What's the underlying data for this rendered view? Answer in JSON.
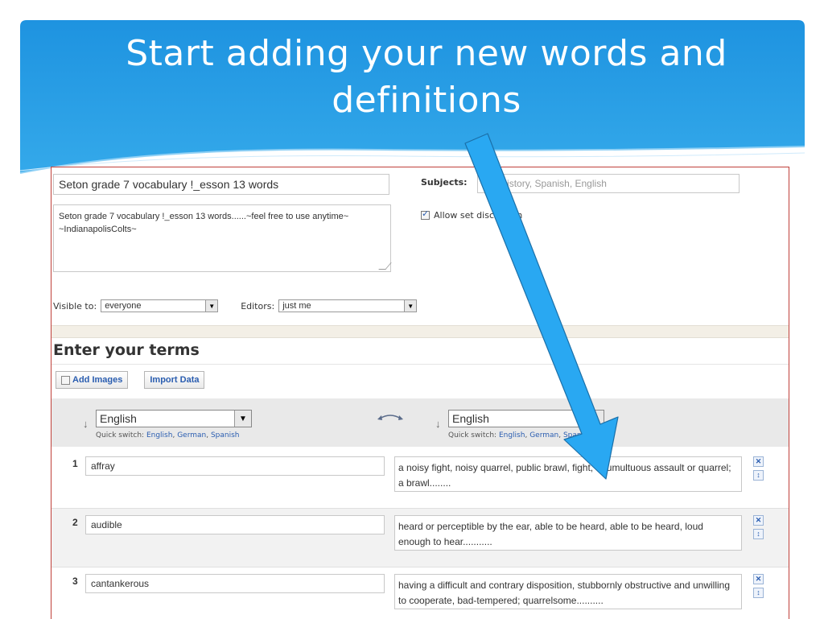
{
  "slide": {
    "title": "Start adding your new words and definitions"
  },
  "set": {
    "title": "Seton grade 7 vocabulary !_esson 13 words",
    "description": "Seton grade 7 vocabulary !_esson 13 words......~feel free to use anytime~ ~IndianapolisColts~",
    "subjects_label": "Subjects:",
    "subjects_placeholder": "e.g. history, Spanish, English",
    "allow_discussion_label": "Allow set discussion",
    "allow_discussion_checked": true,
    "visible_label": "Visible to:",
    "visible_value": "everyone",
    "editors_label": "Editors:",
    "editors_value": "just me"
  },
  "terms_section": {
    "heading": "Enter your terms",
    "add_images_label": "Add Images",
    "import_label": "Import Data",
    "left_language": "English",
    "right_language": "English",
    "quick_switch_label": "Quick switch:",
    "quick_switch_options": [
      "English",
      "German",
      "Spanish"
    ]
  },
  "terms": [
    {
      "num": "1",
      "term": "affray",
      "definition": "a noisy fight, noisy quarrel, public brawl, fight, a tumultuous assault or quarrel; a brawl........"
    },
    {
      "num": "2",
      "term": "audible",
      "definition": "heard or perceptible by the ear, able to be heard, able to be heard, loud enough to hear..........."
    },
    {
      "num": "3",
      "term": "cantankerous",
      "definition": "having a difficult and contrary disposition, stubbornly obstructive and unwilling to cooperate, bad-tempered; quarrelsome.........."
    }
  ],
  "colors": {
    "header_blue": "#2b9fe6",
    "arrow_blue": "#29a8f2",
    "frame_red": "#c0403a",
    "link_blue": "#2a5db0"
  },
  "icons": {
    "delete": "close-icon",
    "reorder": "reorder-icon",
    "swap": "swap-icon",
    "sort": "sort-down-icon"
  }
}
